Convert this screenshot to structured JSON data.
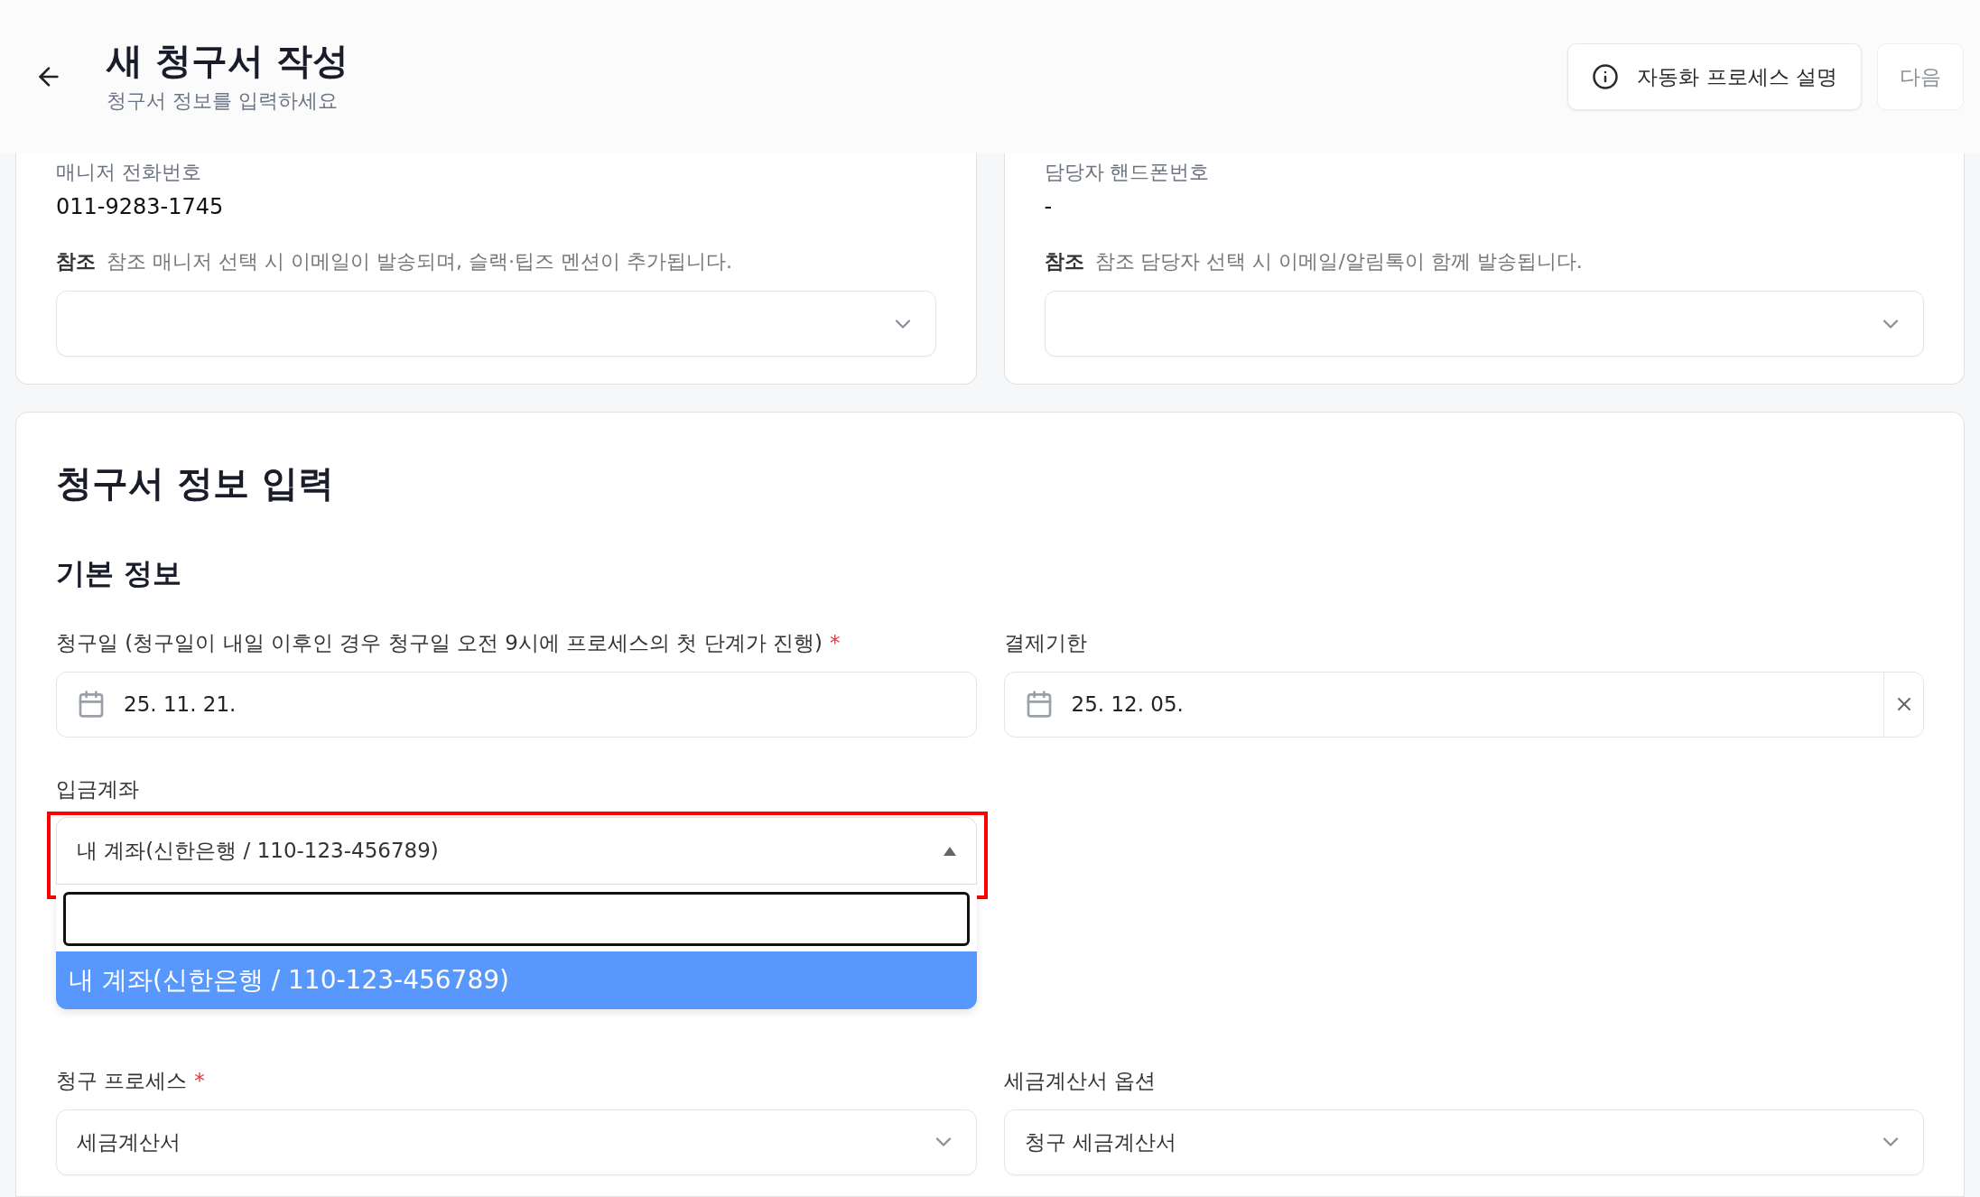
{
  "header": {
    "title": "새 청구서 작성",
    "subtitle": "청구서 정보를 입력하세요",
    "buttons": [
      {
        "kind": "info",
        "label": "자동화 프로세스 설명"
      },
      {
        "kind": "plain",
        "label": "다음"
      }
    ]
  },
  "contact_cards": [
    {
      "field_label": "매니저 전화번호",
      "field_value": "011-9283-1745",
      "note_label": "참조",
      "note_text": "참조 매니저 선택 시 이메일이 발송되며, 슬랙·팁즈 멘션이 추가됩니다."
    },
    {
      "field_label": "담당자 핸드폰번호",
      "field_value": "-",
      "note_label": "참조",
      "note_text": "참조 담당자 선택 시 이메일/알림톡이 함께 발송됩니다."
    }
  ],
  "invoice_form": {
    "title": "청구서 정보 입력",
    "section": "기본 정보",
    "date_fields": [
      {
        "label": "청구일 (청구일이 내일 이후인 경우 청구일 오전 9시에 프로세스의 첫 단계가 진행)",
        "required_mark": "*",
        "value": "25. 11. 21.",
        "clearable": false
      },
      {
        "label": "결제기한",
        "value": "25. 12. 05.",
        "clearable": true
      }
    ],
    "account_field": {
      "label": "입금계좌",
      "value": "내 계좌(신한은행 / 110-123-456789)",
      "expanded": true,
      "highlighted": true,
      "options": [
        {
          "label": "내 계좌(신한은행 / 110-123-456789)",
          "selected": true
        }
      ]
    },
    "process_fields": [
      {
        "label": "청구 프로세스",
        "required_mark": "*",
        "value": "세금계산서"
      },
      {
        "label": "세금계산서 옵션",
        "value": "청구 세금계산서"
      }
    ]
  }
}
